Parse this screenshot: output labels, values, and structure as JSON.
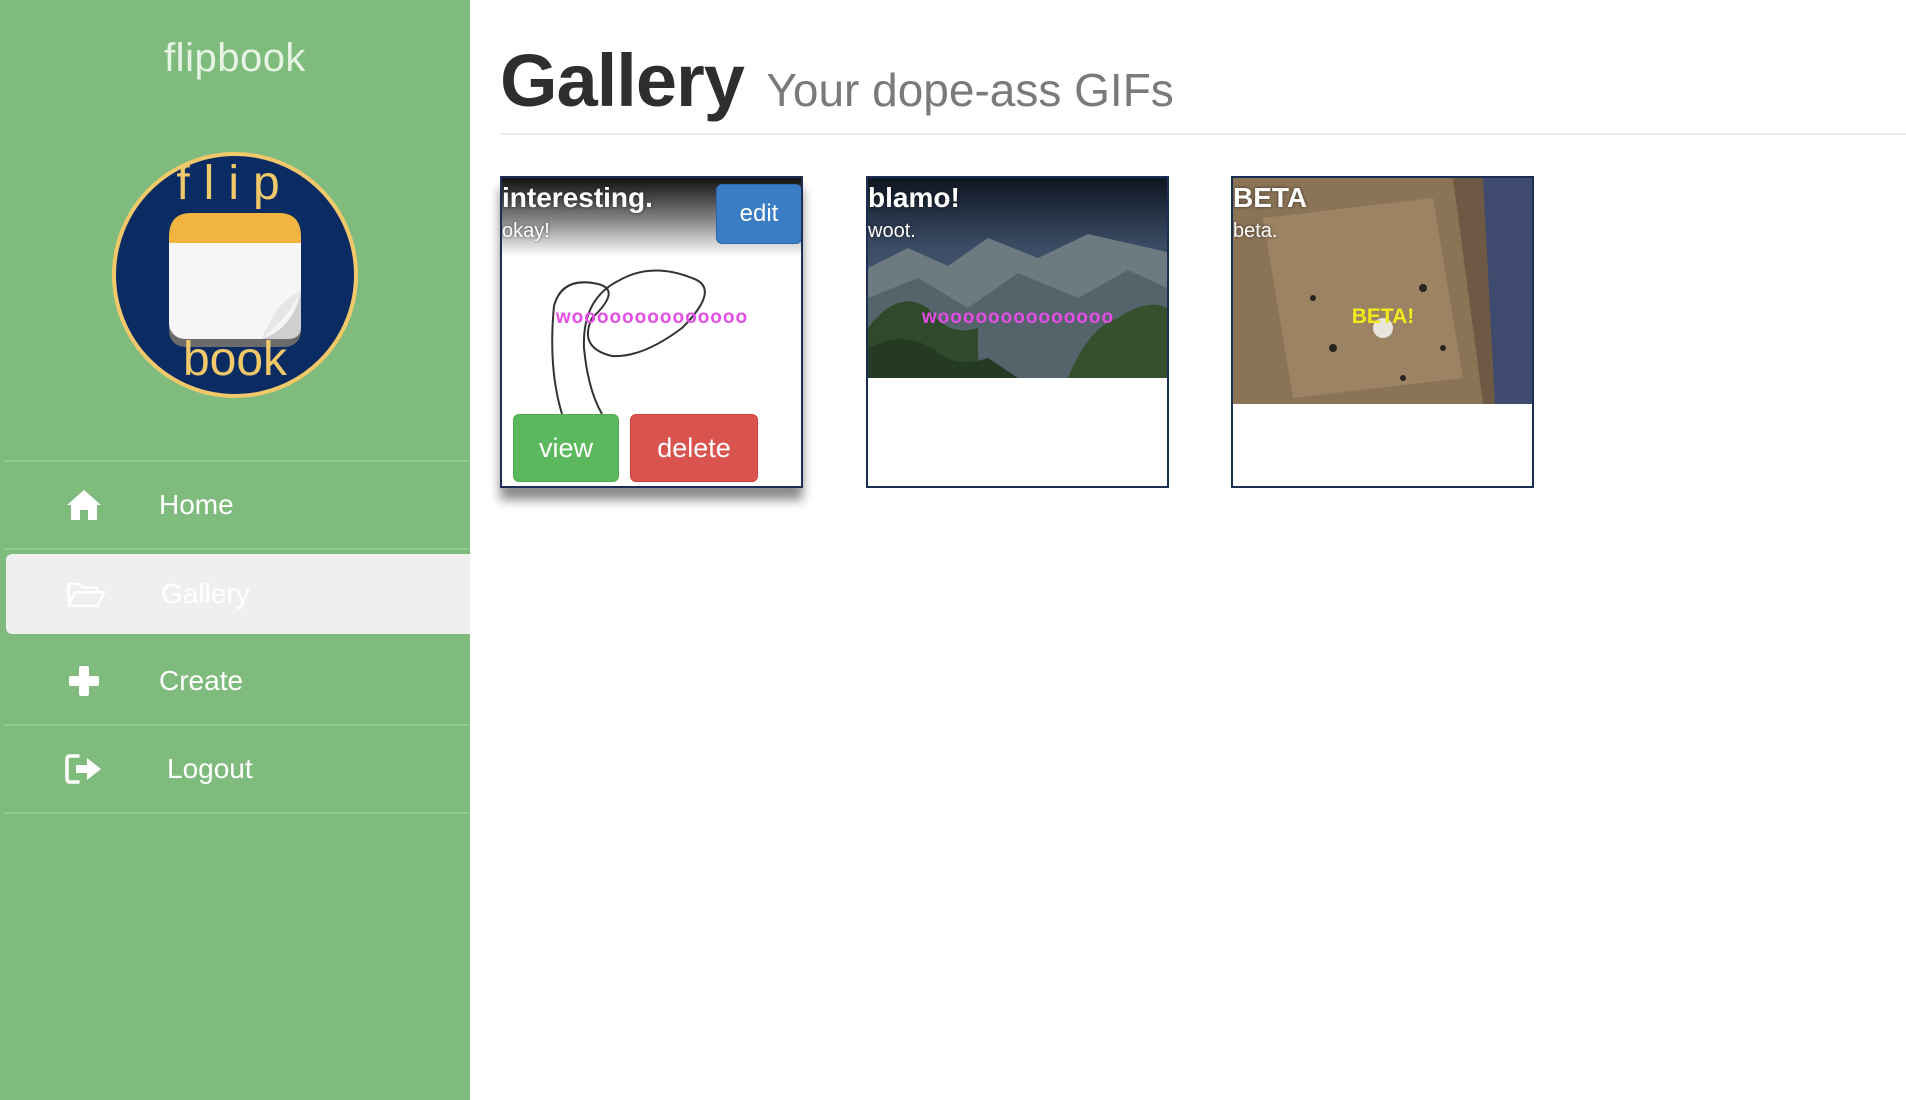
{
  "sidebar": {
    "brand": "flipbook",
    "logo": {
      "top_text": "flip",
      "bottom_text": "book"
    },
    "items": [
      {
        "label": "Home",
        "icon": "home-icon"
      },
      {
        "label": "Gallery",
        "icon": "folder-open-icon",
        "active": true
      },
      {
        "label": "Create",
        "icon": "plus-icon"
      },
      {
        "label": "Logout",
        "icon": "sign-out-icon"
      }
    ]
  },
  "header": {
    "title": "Gallery",
    "subtitle": "Your dope-ass GIFs"
  },
  "gallery": {
    "cards": [
      {
        "title": "interesting.",
        "caption": "okay!",
        "gif_text": "woooooooooooooo",
        "gif_text_color": "#e64de6",
        "buttons": {
          "edit": "edit",
          "view": "view",
          "delete": "delete"
        }
      },
      {
        "title": "blamo!",
        "caption": "woot.",
        "gif_text": "woooooooooooooo",
        "gif_text_color": "#e64de6"
      },
      {
        "title": "BETA",
        "caption": "beta.",
        "gif_text": "BETA!",
        "gif_text_color": "#f2ea1a"
      }
    ]
  },
  "colors": {
    "sidebar_bg": "#7fbb7d",
    "active_item_bg": "#efefef",
    "card_border": "#1c2e55",
    "edit_button": "#3a7dc4",
    "view_button": "#5cb85c",
    "delete_button": "#d9534f",
    "logo_circle": "#0b2c63",
    "logo_ring": "#f2c96a"
  }
}
